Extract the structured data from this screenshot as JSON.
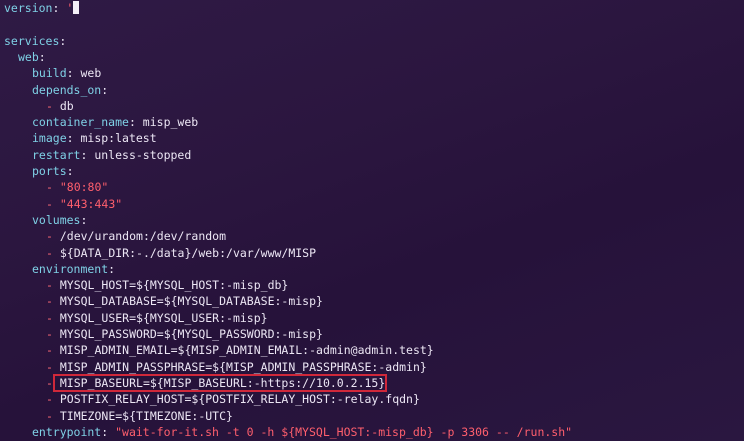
{
  "editor": {
    "lines": [
      {
        "indent": 0,
        "key": "version",
        "sep": ": ",
        "str": "'",
        "cursor": true
      },
      {
        "indent": 0,
        "blank": true
      },
      {
        "indent": 0,
        "key": "services",
        "sep": ":"
      },
      {
        "indent": 1,
        "key": "web",
        "sep": ":"
      },
      {
        "indent": 2,
        "key": "build",
        "sep": ": ",
        "val": "web"
      },
      {
        "indent": 2,
        "key": "depends_on",
        "sep": ":"
      },
      {
        "indent": 3,
        "dash": true,
        "val": "db"
      },
      {
        "indent": 2,
        "key": "container_name",
        "sep": ": ",
        "val": "misp_web"
      },
      {
        "indent": 2,
        "key": "image",
        "sep": ": ",
        "val": "misp:latest"
      },
      {
        "indent": 2,
        "key": "restart",
        "sep": ": ",
        "val": "unless-stopped"
      },
      {
        "indent": 2,
        "key": "ports",
        "sep": ":"
      },
      {
        "indent": 3,
        "dash": true,
        "str": "\"80:80\""
      },
      {
        "indent": 3,
        "dash": true,
        "str": "\"443:443\""
      },
      {
        "indent": 2,
        "key": "volumes",
        "sep": ":"
      },
      {
        "indent": 3,
        "dash": true,
        "val": "/dev/urandom:/dev/random"
      },
      {
        "indent": 3,
        "dash": true,
        "val": "${DATA_DIR:-./data}/web:/var/www/MISP"
      },
      {
        "indent": 2,
        "key": "environment",
        "sep": ":"
      },
      {
        "indent": 3,
        "dash": true,
        "val": "MYSQL_HOST=${MYSQL_HOST:-misp_db}"
      },
      {
        "indent": 3,
        "dash": true,
        "val": "MYSQL_DATABASE=${MYSQL_DATABASE:-misp}"
      },
      {
        "indent": 3,
        "dash": true,
        "val": "MYSQL_USER=${MYSQL_USER:-misp}"
      },
      {
        "indent": 3,
        "dash": true,
        "val": "MYSQL_PASSWORD=${MYSQL_PASSWORD:-misp}"
      },
      {
        "indent": 3,
        "dash": true,
        "val": "MISP_ADMIN_EMAIL=${MISP_ADMIN_EMAIL:-admin@admin.test}"
      },
      {
        "indent": 3,
        "dash": true,
        "val": "MISP_ADMIN_PASSPHRASE=${MISP_ADMIN_PASSPHRASE:-admin}"
      },
      {
        "indent": 3,
        "dash": true,
        "val": "MISP_BASEURL=${MISP_BASEURL:-https://10.0.2.15}",
        "highlighted": true
      },
      {
        "indent": 3,
        "dash": true,
        "val": "POSTFIX_RELAY_HOST=${POSTFIX_RELAY_HOST:-relay.fqdn}"
      },
      {
        "indent": 3,
        "dash": true,
        "val": "TIMEZONE=${TIMEZONE:-UTC}"
      },
      {
        "indent": 2,
        "key": "entrypoint",
        "sep": ": ",
        "str": "\"wait-for-it.sh -t 0 -h ${MYSQL_HOST:-misp_db} -p 3306 -- /run.sh\""
      }
    ]
  },
  "colors": {
    "key": "#7fd1e6",
    "value": "#ece6f4",
    "string": "#ff5f6d",
    "highlight_border": "#d0283a"
  }
}
